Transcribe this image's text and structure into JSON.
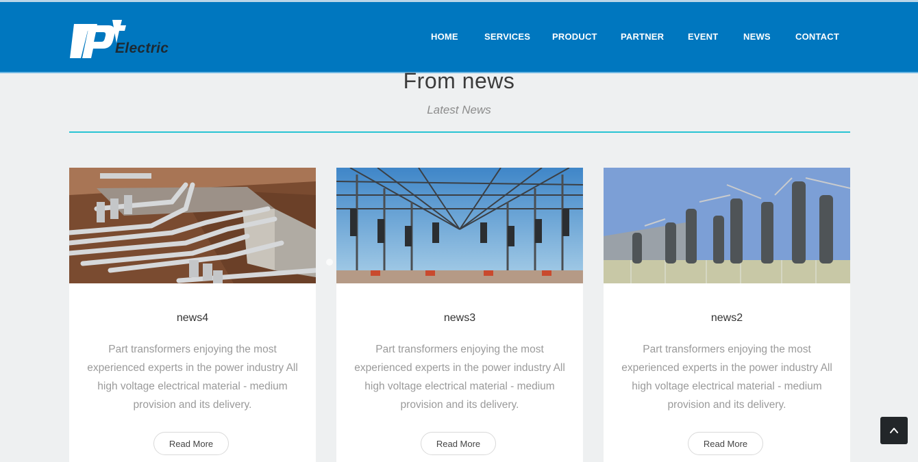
{
  "header": {
    "logo": {
      "mark": "pt",
      "word": "Electric"
    },
    "nav": [
      {
        "label": "HOME"
      },
      {
        "label": "SERVICES"
      },
      {
        "label": "PRODUCT"
      },
      {
        "label": "PARTNER"
      },
      {
        "label": "EVENT"
      },
      {
        "label": "NEWS"
      },
      {
        "label": "CONTACT"
      }
    ]
  },
  "section": {
    "title": "From news",
    "subtitle": "Latest News"
  },
  "cards": [
    {
      "title": "news4",
      "text": "Part transformers enjoying the most experienced experts in the power industry All high voltage electrical material - medium provision and its delivery.",
      "button": "Read More"
    },
    {
      "title": "news3",
      "text": "Part transformers enjoying the most experienced experts in the power industry All high voltage electrical material - medium provision and its delivery.",
      "button": "Read More"
    },
    {
      "title": "news2",
      "text": "Part transformers enjoying the most experienced experts in the power industry All high voltage electrical material - medium provision and its delivery.",
      "button": "Read More"
    }
  ],
  "colors": {
    "header_bg": "#0077bf",
    "accent_line": "#27c3d3",
    "page_bg": "#eef0f1"
  },
  "icons": {
    "back_to_top": "chevron-up-icon"
  }
}
